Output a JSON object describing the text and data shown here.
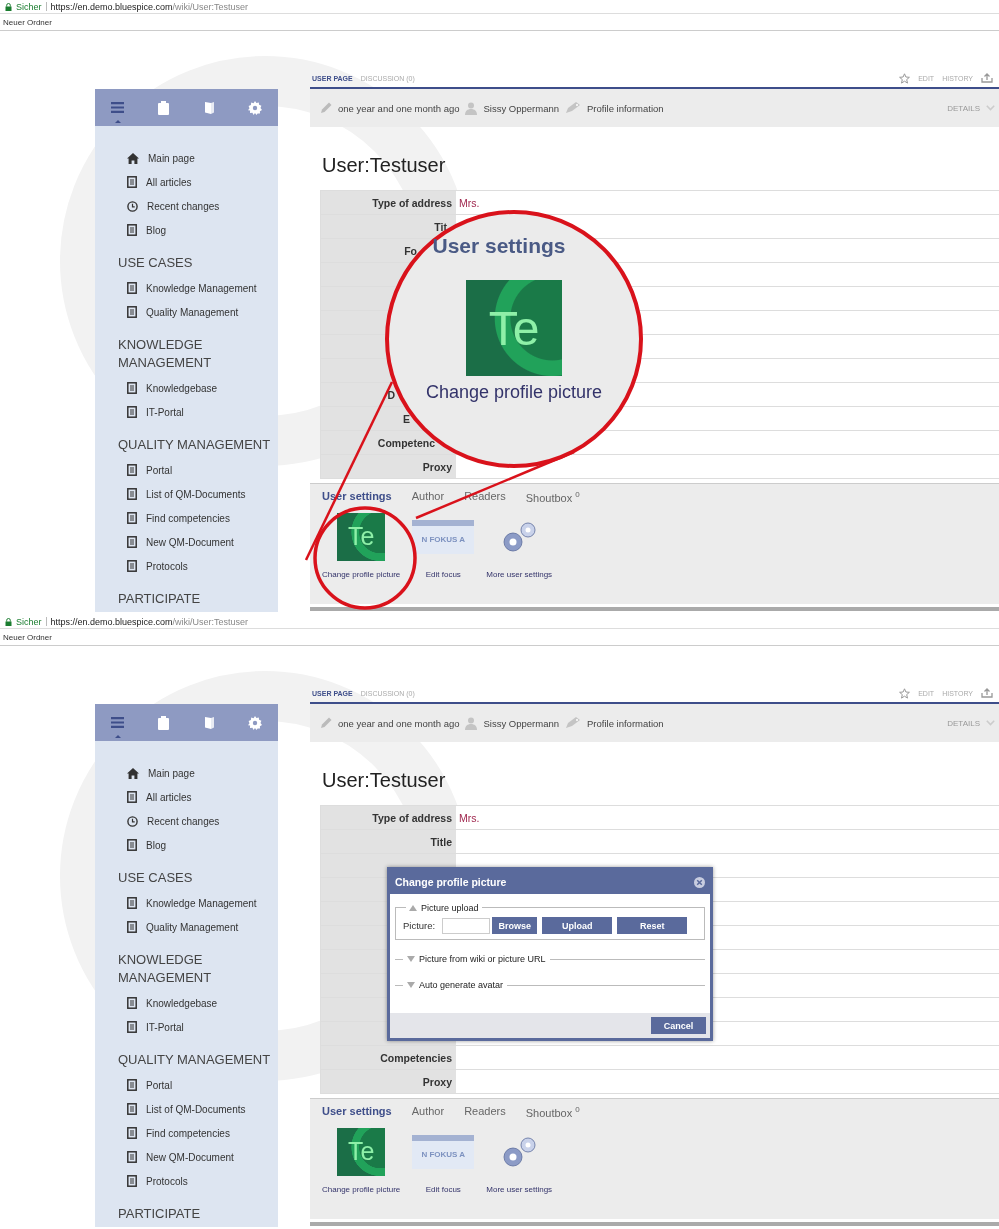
{
  "panels": [
    {
      "browser": {
        "secure": "Sicher",
        "url_host": "https://en.demo.bluespice.com",
        "url_path": "/wiki/User:Testuser"
      },
      "bookmarks": [
        "Neuer Ordner"
      ],
      "sidebar": {
        "tabs": [
          {
            "selected": true
          },
          {
            "selected": false
          },
          {
            "selected": false
          },
          {
            "selected": false
          }
        ],
        "sections": [
          {
            "items": [
              {
                "label": "Main page",
                "kind": "home"
              },
              {
                "label": "All articles",
                "kind": "page"
              },
              {
                "label": "Recent changes",
                "kind": "clock"
              },
              {
                "label": "Blog",
                "kind": "page"
              }
            ]
          },
          {
            "heading": "USE CASES",
            "items": [
              {
                "label": "Knowledge Management",
                "kind": "page"
              },
              {
                "label": "Quality Management",
                "kind": "page"
              }
            ]
          },
          {
            "heading": "KNOWLEDGE MANAGEMENT",
            "items": [
              {
                "label": "Knowledgebase",
                "kind": "page"
              },
              {
                "label": "IT-Portal",
                "kind": "page"
              }
            ]
          },
          {
            "heading": "QUALITY MANAGEMENT",
            "items": [
              {
                "label": "Portal",
                "kind": "page"
              },
              {
                "label": "List of QM-Documents",
                "kind": "page"
              },
              {
                "label": "Find competencies",
                "kind": "page"
              },
              {
                "label": "New QM-Document",
                "kind": "page"
              },
              {
                "label": "Protocols",
                "kind": "page"
              }
            ]
          },
          {
            "heading": "PARTICIPATE"
          }
        ]
      },
      "page_tabs": [
        {
          "label": "USER PAGE",
          "selected": true
        },
        {
          "label": "DISCUSSION (0)",
          "selected": false
        }
      ],
      "page_actions": [
        "EDIT",
        "HISTORY"
      ],
      "meta": {
        "modified": "one year and one month ago",
        "author": "Sissy Oppermann",
        "category": "Profile information",
        "details": "DETAILS"
      },
      "title": "User:Testuser",
      "table": {
        "rows": [
          {
            "label": "Type of address",
            "value": "Mrs."
          },
          {
            "label": "Tit"
          },
          {
            "label": "Fo"
          },
          {},
          {},
          {},
          {},
          {},
          {
            "label": "D"
          },
          {
            "label": "E"
          },
          {
            "label": "Competenc"
          },
          {
            "label": "Proxy"
          }
        ]
      },
      "bottom_tabs": [
        {
          "label": "User settings",
          "selected": true
        },
        {
          "label": "Author",
          "selected": false
        },
        {
          "label": "Readers",
          "selected": false
        },
        {
          "label": "Shoutbox $^{0}$",
          "selected": false
        }
      ],
      "tools": [
        {
          "image_text": "Te",
          "label": "Change profile picture"
        },
        {
          "kind": "focus",
          "image_text": "N FOKUS A",
          "label": "Edit focus"
        },
        {
          "kind": "gears",
          "label": "More user settings"
        }
      ],
      "magnifier": {
        "heading": "User settings",
        "image_text": "Te",
        "caption": "Change profile picture"
      }
    },
    {
      "browser": {
        "secure": "Sicher",
        "url_host": "https://en.demo.bluespice.com",
        "url_path": "/wiki/User:Testuser"
      },
      "bookmarks": [
        "Neuer Ordner"
      ],
      "sidebar": {
        "tabs": [
          {
            "selected": true
          },
          {
            "selected": false
          },
          {
            "selected": false
          },
          {
            "selected": false
          }
        ],
        "sections": [
          {
            "items": [
              {
                "label": "Main page",
                "kind": "home"
              },
              {
                "label": "All articles",
                "kind": "page"
              },
              {
                "label": "Recent changes",
                "kind": "clock"
              },
              {
                "label": "Blog",
                "kind": "page"
              }
            ]
          },
          {
            "heading": "USE CASES",
            "items": [
              {
                "label": "Knowledge Management",
                "kind": "page"
              },
              {
                "label": "Quality Management",
                "kind": "page"
              }
            ]
          },
          {
            "heading": "KNOWLEDGE MANAGEMENT",
            "items": [
              {
                "label": "Knowledgebase",
                "kind": "page"
              },
              {
                "label": "IT-Portal",
                "kind": "page"
              }
            ]
          },
          {
            "heading": "QUALITY MANAGEMENT",
            "items": [
              {
                "label": "Portal",
                "kind": "page"
              },
              {
                "label": "List of QM-Documents",
                "kind": "page"
              },
              {
                "label": "Find competencies",
                "kind": "page"
              },
              {
                "label": "New QM-Document",
                "kind": "page"
              },
              {
                "label": "Protocols",
                "kind": "page"
              }
            ]
          },
          {
            "heading": "PARTICIPATE"
          }
        ]
      },
      "page_tabs": [
        {
          "label": "USER PAGE",
          "selected": true
        },
        {
          "label": "DISCUSSION (0)",
          "selected": false
        }
      ],
      "page_actions": [
        "EDIT",
        "HISTORY"
      ],
      "meta": {
        "modified": "one year and one month ago",
        "author": "Sissy Oppermann",
        "category": "Profile information",
        "details": "DETAILS"
      },
      "title": "User:Testuser",
      "table": {
        "rows": [
          {
            "label": "Type of address",
            "value": "Mrs."
          },
          {
            "label": "Title"
          },
          {},
          {},
          {},
          {},
          {},
          {},
          {},
          {},
          {
            "label": "Competencies"
          },
          {
            "label": "Proxy"
          }
        ]
      },
      "bottom_tabs": [
        {
          "label": "User settings",
          "selected": true
        },
        {
          "label": "Author",
          "selected": false
        },
        {
          "label": "Readers",
          "selected": false
        },
        {
          "label": "Shoutbox $^{0}$",
          "selected": false
        }
      ],
      "tools": [
        {
          "image_text": "Te",
          "label": "Change profile picture"
        },
        {
          "kind": "focus",
          "image_text": "N FOKUS A",
          "label": "Edit focus"
        },
        {
          "kind": "gears",
          "label": "More user settings"
        }
      ],
      "dialog": {
        "title": "Change profile picture",
        "sections": [
          {
            "title": "Picture upload",
            "expanded": true,
            "field_label": "Picture:",
            "buttons": [
              "Browse",
              "Upload",
              "Reset"
            ]
          },
          {
            "title": "Picture from wiki or picture URL",
            "expanded": false
          },
          {
            "title": "Auto generate avatar",
            "expanded": false
          }
        ],
        "footer_buttons": [
          "Cancel"
        ]
      }
    }
  ]
}
